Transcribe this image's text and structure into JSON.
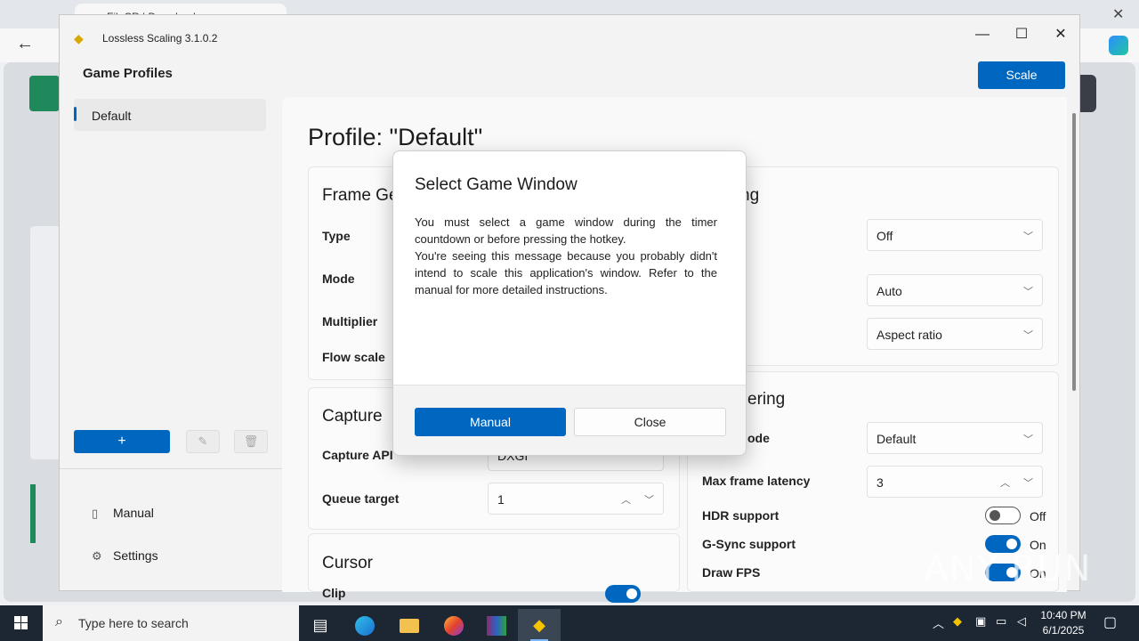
{
  "browser": {
    "tab_title": "FileCR | Download"
  },
  "app": {
    "title": "Lossless Scaling 3.1.0.2",
    "scale_button": "Scale",
    "sidebar": {
      "title": "Game Profiles",
      "profiles": [
        "Default"
      ],
      "add_label": "+",
      "nav": [
        {
          "label": "Manual",
          "icon": "book-icon"
        },
        {
          "label": "Settings",
          "icon": "gear-icon"
        }
      ]
    },
    "profile_heading": "Profile: \"Default\"",
    "frame_gen": {
      "title": "Frame Ge",
      "fields": [
        "Type",
        "Mode",
        "Multiplier",
        "Flow scale"
      ]
    },
    "capture": {
      "title": "Capture",
      "api_label": "Capture API",
      "api_value": "DXGI",
      "queue_label": "Queue target",
      "queue_value": "1"
    },
    "cursor": {
      "title": "Cursor",
      "clip_label": "Clip",
      "clip_state": "On"
    },
    "scaling": {
      "title_fragment": "ng",
      "dropdown1": "Off",
      "dropdown2": "Auto",
      "dropdown3": "Aspect ratio"
    },
    "rendering": {
      "title_fragment": "ering",
      "sync_label_fragment": "ode",
      "sync_value": "Default",
      "latency_label": "Max frame latency",
      "latency_value": "3",
      "hdr_label": "HDR support",
      "hdr_state": "Off",
      "gsync_label": "G-Sync support",
      "gsync_state": "On",
      "fps_label": "Draw FPS",
      "fps_state": "On"
    }
  },
  "dialog": {
    "title": "Select Game Window",
    "paragraph1": "You must select a game window during the timer countdown or before pressing the hotkey.",
    "paragraph2": "You're seeing this message because you probably didn't intend to scale this application's window. Refer to the manual for more detailed instructions.",
    "primary": "Manual",
    "secondary": "Close"
  },
  "watermark": "ANY RUN",
  "taskbar": {
    "search_placeholder": "Type here to search",
    "time": "10:40 PM",
    "date": "6/1/2025"
  },
  "colors": {
    "accent": "#0067c0",
    "taskbar": "#1c2733"
  }
}
